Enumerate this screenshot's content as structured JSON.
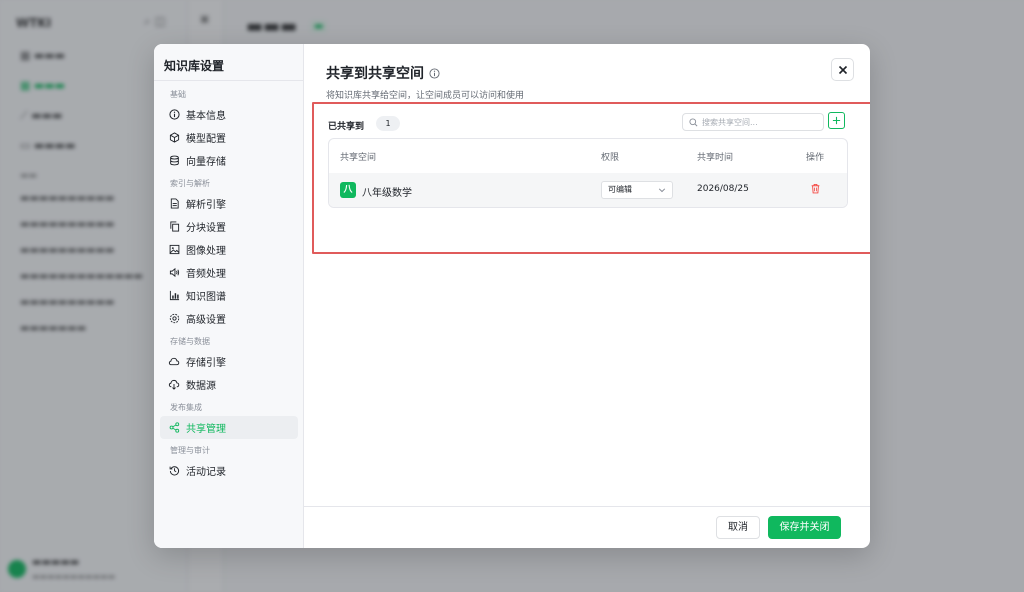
{
  "modal": {
    "sidebar": {
      "title": "知识库设置",
      "sections": [
        {
          "label": "基础",
          "items": [
            {
              "label": "基本信息",
              "icon": "info-icon"
            },
            {
              "label": "模型配置",
              "icon": "cube-icon"
            },
            {
              "label": "向量存储",
              "icon": "database-icon"
            }
          ]
        },
        {
          "label": "索引与解析",
          "items": [
            {
              "label": "解析引擎",
              "icon": "file-parse-icon"
            },
            {
              "label": "分块设置",
              "icon": "copy-icon"
            },
            {
              "label": "图像处理",
              "icon": "image-icon"
            },
            {
              "label": "音频处理",
              "icon": "speaker-icon"
            },
            {
              "label": "知识图谱",
              "icon": "chart-icon"
            },
            {
              "label": "高级设置",
              "icon": "gear-icon"
            }
          ]
        },
        {
          "label": "存储与数据",
          "items": [
            {
              "label": "存储引擎",
              "icon": "cloud-icon"
            },
            {
              "label": "数据源",
              "icon": "cloud-download-icon"
            }
          ]
        },
        {
          "label": "发布集成",
          "items": [
            {
              "label": "共享管理",
              "icon": "share-icon",
              "active": true
            }
          ]
        },
        {
          "label": "管理与审计",
          "items": [
            {
              "label": "活动记录",
              "icon": "history-icon"
            }
          ]
        }
      ]
    },
    "content": {
      "title": "共享到共享空间",
      "description": "将知识库共享给空间，让空间成员可以访问和使用",
      "shared_label": "已共享到",
      "shared_count": "1",
      "search_placeholder": "搜索共享空间...",
      "columns": [
        "共享空间",
        "权限",
        "共享时间",
        "操作"
      ],
      "rows": [
        {
          "avatar": "八",
          "name": "八年级数学",
          "permission": "可编辑",
          "time": "2026/08/25"
        }
      ]
    },
    "footer": {
      "cancel": "取消",
      "save": "保存并关闭"
    }
  },
  "colors": {
    "accent": "#10b85e",
    "highlight_border": "#e05b5b",
    "danger": "#f54a45"
  }
}
